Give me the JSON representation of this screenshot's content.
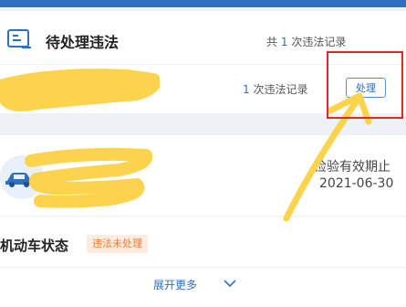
{
  "pending": {
    "title": "待处理违法",
    "summary_prefix": "共",
    "summary_count": "1",
    "summary_suffix": "次违法记录",
    "record_count": "1",
    "record_suffix": "次违法记录",
    "process_button": "处理"
  },
  "vehicle": {
    "inspection_label": "检验有效期止",
    "inspection_date": "2021-06-30",
    "status_label": "机动车状态",
    "status_badge": "违法未处理",
    "expand_label": "展开更多"
  },
  "icons": {
    "record_icon": "document-list-icon",
    "car_icon": "car-icon",
    "expand_icon": "chevron-down-icon"
  },
  "colors": {
    "accent": "#2f6fbf",
    "badge_text": "#f07b32",
    "badge_bg": "#fdecdf",
    "annotation_box": "#e6262a",
    "scribble": "#fcd34d"
  }
}
